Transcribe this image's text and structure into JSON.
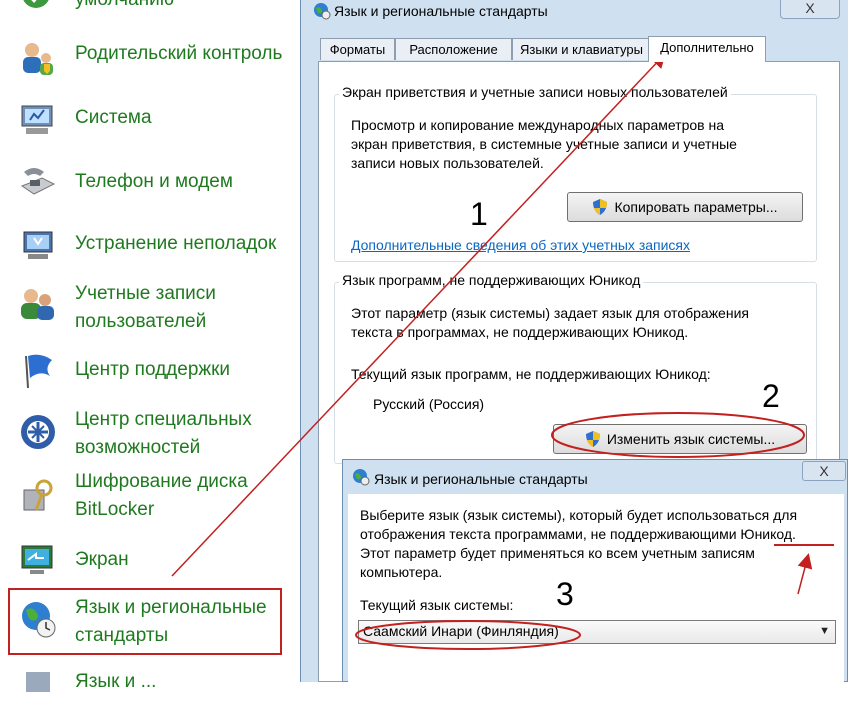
{
  "control_panel": {
    "items": [
      {
        "label": "умолчанию",
        "icon": "default-programs-icon"
      },
      {
        "label": "Родительский контроль",
        "icon": "parental-controls-icon"
      },
      {
        "label": "Система",
        "icon": "system-icon"
      },
      {
        "label": "Телефон и модем",
        "icon": "phone-modem-icon"
      },
      {
        "label": "Устранение неполадок",
        "icon": "troubleshooting-icon"
      },
      {
        "label_line1": "Учетные записи",
        "label_line2": "пользователей",
        "icon": "user-accounts-icon"
      },
      {
        "label": "Центр поддержки",
        "icon": "action-center-flag-icon"
      },
      {
        "label_line1": "Центр специальных",
        "label_line2": "возможностей",
        "icon": "ease-of-access-icon"
      },
      {
        "label_line1": "Шифрование диска",
        "label_line2": "BitLocker",
        "icon": "bitlocker-icon"
      },
      {
        "label": "Экран",
        "icon": "display-icon"
      },
      {
        "label_line1": "Язык и региональные",
        "label_line2": "стандарты",
        "icon": "region-language-globe-icon"
      },
      {
        "label": "Язык и ...",
        "icon": "partial-item-icon"
      }
    ]
  },
  "main_dialog": {
    "title": "Язык и региональные стандарты",
    "close_label": "X",
    "tabs": [
      "Форматы",
      "Расположение",
      "Языки и клавиатуры",
      "Дополнительно"
    ],
    "active_tab": "Дополнительно",
    "welcome_group": {
      "legend": "Экран приветствия и учетные записи новых пользователей",
      "line1": "Просмотр и копирование международных параметров на",
      "line2": "экран приветствия, в системные учетные записи и учетные",
      "line3": "записи новых пользователей.",
      "copy_button": "Копировать параметры...",
      "link": "Дополнительные сведения об этих учетных записях"
    },
    "unicode_group": {
      "legend": "Язык программ, не поддерживающих Юникод",
      "line1": "Этот параметр (язык системы) задает язык для отображения",
      "line2": "текста в программах, не поддерживающих Юникод.",
      "current_label": "Текущий язык программ, не поддерживающих Юникод:",
      "current_value": "Русский (Россия)",
      "change_button": "Изменить язык системы..."
    }
  },
  "system_locale_dialog": {
    "title": "Язык и региональные стандарты",
    "close_label": "X",
    "line1": "Выберите язык (язык системы), который будет использоваться для",
    "line2": "отображения текста программами, не поддерживающими Юникод.",
    "line3": "Этот параметр будет применяться ко всем учетным записям",
    "line4": "компьютера.",
    "current_label": "Текущий язык системы:",
    "selected_value": "Саамский Инари (Финляндия)"
  },
  "annotations": {
    "step1": "1",
    "step2": "2",
    "step3": "3",
    "color": "#c32020"
  },
  "colors": {
    "cp_link": "#1f7a1f",
    "dialog_frame": "#cfe0f1",
    "hyperlink": "#0b67c2"
  }
}
